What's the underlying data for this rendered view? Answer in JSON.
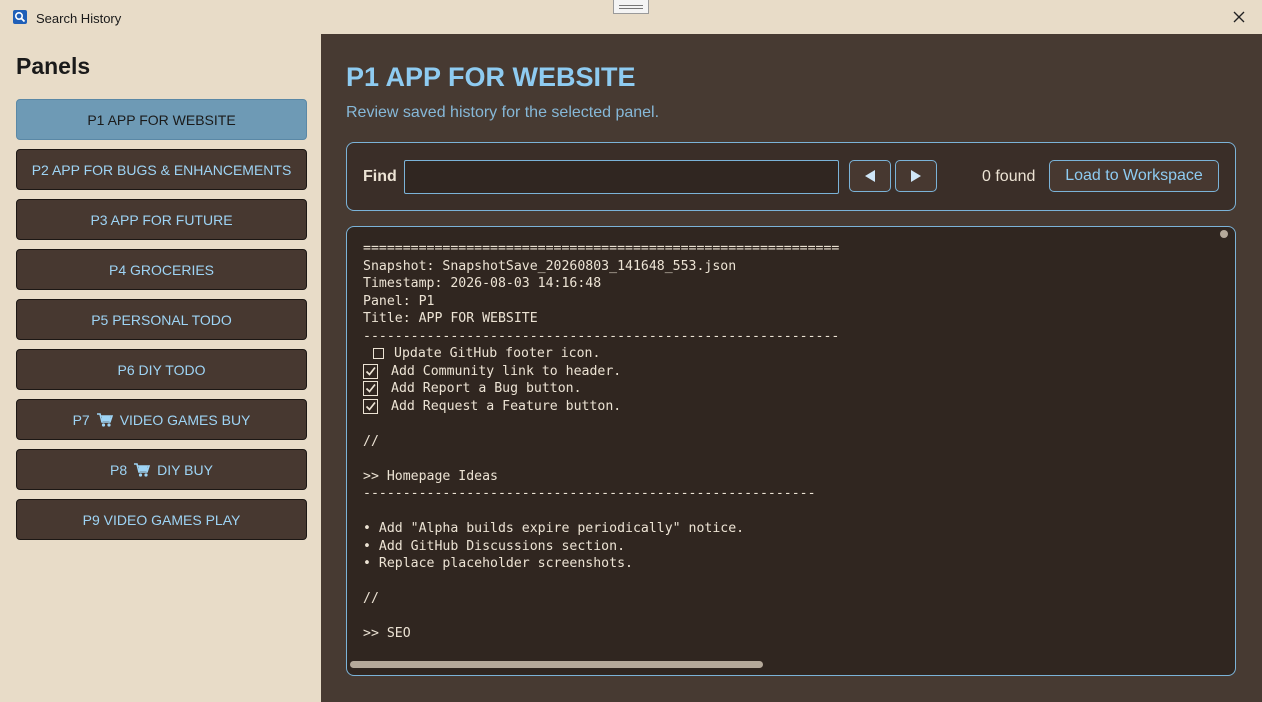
{
  "window": {
    "title": "Search History"
  },
  "sidebar": {
    "title": "Panels",
    "panels": [
      {
        "label": "P1  APP FOR WEBSITE",
        "active": true,
        "cart": false
      },
      {
        "label": "P2  APP FOR BUGS & ENHANCEMENTS",
        "active": false,
        "cart": false
      },
      {
        "label": "P3  APP FOR FUTURE",
        "active": false,
        "cart": false
      },
      {
        "label": "P4  GROCERIES",
        "active": false,
        "cart": false
      },
      {
        "label": "P5  PERSONAL TODO",
        "active": false,
        "cart": false
      },
      {
        "label": "P6  DIY TODO",
        "active": false,
        "cart": false
      },
      {
        "label": "P7",
        "label_after_icon": "VIDEO GAMES BUY",
        "active": false,
        "cart": true
      },
      {
        "label": "P8",
        "label_after_icon": "DIY BUY",
        "active": false,
        "cart": true
      },
      {
        "label": "P9  VIDEO GAMES PLAY",
        "active": false,
        "cart": false
      }
    ]
  },
  "main": {
    "title": "P1 APP FOR WEBSITE",
    "subtitle": "Review saved history for the selected panel.",
    "find": {
      "label": "Find",
      "value": "",
      "placeholder": "",
      "found_text": "0 found",
      "load_button": "Load to Workspace"
    },
    "history": {
      "lines": [
        {
          "type": "text",
          "text": "============================================================"
        },
        {
          "type": "text",
          "text": "Snapshot: SnapshotSave_20260803_141648_553.json"
        },
        {
          "type": "text",
          "text": "Timestamp: 2026-08-03 14:16:48"
        },
        {
          "type": "text",
          "text": "Panel: P1"
        },
        {
          "type": "text",
          "text": "Title: APP FOR WEBSITE"
        },
        {
          "type": "text",
          "text": "------------------------------------------------------------"
        },
        {
          "type": "check",
          "checked": false,
          "text": "Update GitHub footer icon."
        },
        {
          "type": "check",
          "checked": true,
          "text": "Add Community link to header."
        },
        {
          "type": "check",
          "checked": true,
          "text": "Add Report a Bug button."
        },
        {
          "type": "check",
          "checked": true,
          "text": "Add Request a Feature button."
        },
        {
          "type": "text",
          "text": ""
        },
        {
          "type": "text",
          "text": "//"
        },
        {
          "type": "text",
          "text": ""
        },
        {
          "type": "text",
          "text": ">> Homepage Ideas"
        },
        {
          "type": "text",
          "text": "---------------------------------------------------------"
        },
        {
          "type": "text",
          "text": ""
        },
        {
          "type": "text",
          "text": "• Add \"Alpha builds expire periodically\" notice."
        },
        {
          "type": "text",
          "text": "• Add GitHub Discussions section."
        },
        {
          "type": "text",
          "text": "• Replace placeholder screenshots."
        },
        {
          "type": "text",
          "text": ""
        },
        {
          "type": "text",
          "text": "//"
        },
        {
          "type": "text",
          "text": ""
        },
        {
          "type": "text",
          "text": ">> SEO"
        }
      ]
    }
  },
  "colors": {
    "chrome_bg": "#e8dcc8",
    "main_bg": "#473a32",
    "accent": "#8ecbf1",
    "active_panel": "#6e9ab5",
    "border": "#7bb3d8"
  }
}
